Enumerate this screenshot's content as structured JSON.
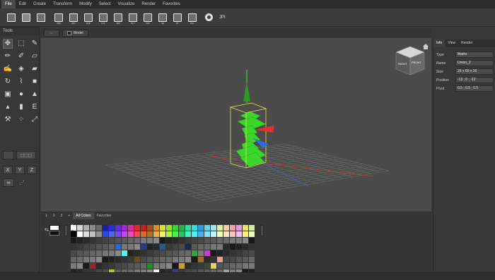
{
  "menubar": {
    "items": [
      "File",
      "Edit",
      "Create",
      "Transform",
      "Modify",
      "Select",
      "Visualize",
      "Render",
      "Favorites"
    ]
  },
  "toolbar": {
    "buttons": [
      {
        "icon": "new-file-icon",
        "label": ""
      },
      {
        "icon": "save-file-icon",
        "label": ""
      },
      {
        "icon": "print-icon",
        "label": ""
      },
      {
        "icon": "fbx-export-icon",
        "label": "FBX"
      },
      {
        "icon": "obj-export-icon",
        "label": "OBJ"
      },
      {
        "icon": "dae-export-icon",
        "label": "DAE"
      },
      {
        "icon": "stl-export-icon",
        "label": "STL"
      },
      {
        "icon": "3ds-export-icon",
        "label": "3DS"
      },
      {
        "icon": "ply-export-icon",
        "label": "PLY"
      },
      {
        "icon": "vox-export-icon",
        "label": "VOX"
      },
      {
        "icon": "qb-export-icon",
        "label": "QB"
      },
      {
        "icon": "mc-export-icon",
        "label": "MC"
      },
      {
        "icon": "pal-export-icon",
        "label": "PAL"
      }
    ],
    "settings_icon": "gear-icon",
    "extra_label": "JPI"
  },
  "tools": {
    "title": "Tools",
    "icons": [
      "move-icon",
      "select-box-icon",
      "eyedropper-icon",
      "pencil-icon",
      "brush-icon",
      "eraser-icon",
      "paint-brush-icon",
      "fill-bucket-icon",
      "paint-roller-icon",
      "rotate-icon",
      "face-select-icon",
      "cube-icon",
      "box-icon",
      "sphere-icon",
      "cone-icon",
      "cone-icon-2",
      "cylinder-icon",
      "extrude-icon",
      "wand-icon",
      "dotted-select-icon",
      "resize-icon"
    ],
    "axis_buttons": [
      "X",
      "Y",
      "Z"
    ]
  },
  "viewport": {
    "tab_back": "←",
    "tab_model": "Model",
    "cube_top": "",
    "cube_left": "RIGHT",
    "cube_right": "FRONT",
    "home_icon": "home-icon"
  },
  "right_panel": {
    "tabs": [
      "Info",
      "View",
      "Render"
    ],
    "properties": [
      {
        "key": "Type",
        "value": "Matrix"
      },
      {
        "key": "Name",
        "value": "Union_2"
      },
      {
        "key": "Size",
        "value": "26 x 60 x 26"
      },
      {
        "key": "Position",
        "value": "-13 ; 0 ; -12"
      },
      {
        "key": "Pivot",
        "value": "0.5 ; 0.5 ; 0.5"
      }
    ]
  },
  "palette": {
    "tabs": [
      "1",
      "2",
      "3",
      "+",
      "All Colors",
      "Favorites"
    ],
    "active_tab": "All Colors",
    "slot_1": "1",
    "slot_2": "2"
  },
  "colors": {
    "accent_green": "#3ad62a",
    "axis_red": "#e03030",
    "axis_blue": "#2e6ce0",
    "selection_yellow": "#e6e64a"
  }
}
